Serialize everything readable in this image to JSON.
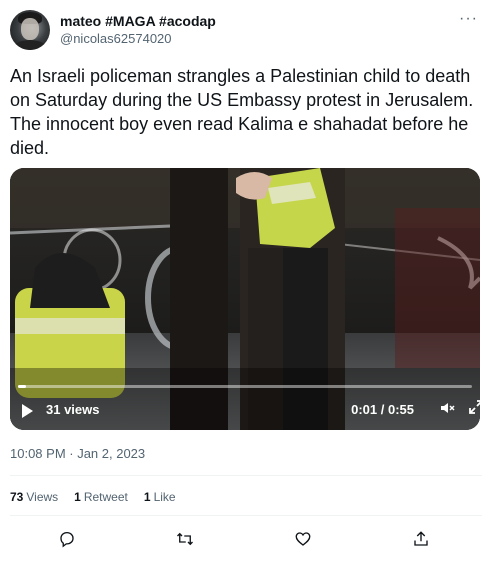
{
  "author": {
    "display_name": "mateo #MAGA #acodap",
    "handle": "@nicolas62574020"
  },
  "menu": {
    "more_glyph": "···"
  },
  "tweet": {
    "text": "An Israeli policeman strangles a Palestinian child to death on Saturday during the US Embassy protest in Jerusalem. The innocent boy even read Kalima e shahadat before he died."
  },
  "video": {
    "views_label": "31 views",
    "time_label": "0:01 / 0:55",
    "progress_fraction": 0.018,
    "mute_icon": "speaker-muted-icon",
    "fullscreen_icon": "expand-icon"
  },
  "timestamp": "10:08 PM · Jan 2, 2023",
  "stats": [
    {
      "count": "73",
      "label": "Views"
    },
    {
      "count": "1",
      "label": "Retweet"
    },
    {
      "count": "1",
      "label": "Like"
    }
  ],
  "actions": [
    "reply-icon",
    "retweet-icon",
    "like-icon",
    "share-icon"
  ],
  "colors": {
    "text": "#0f1419",
    "secondary": "#536471",
    "divider": "#eff3f4"
  }
}
